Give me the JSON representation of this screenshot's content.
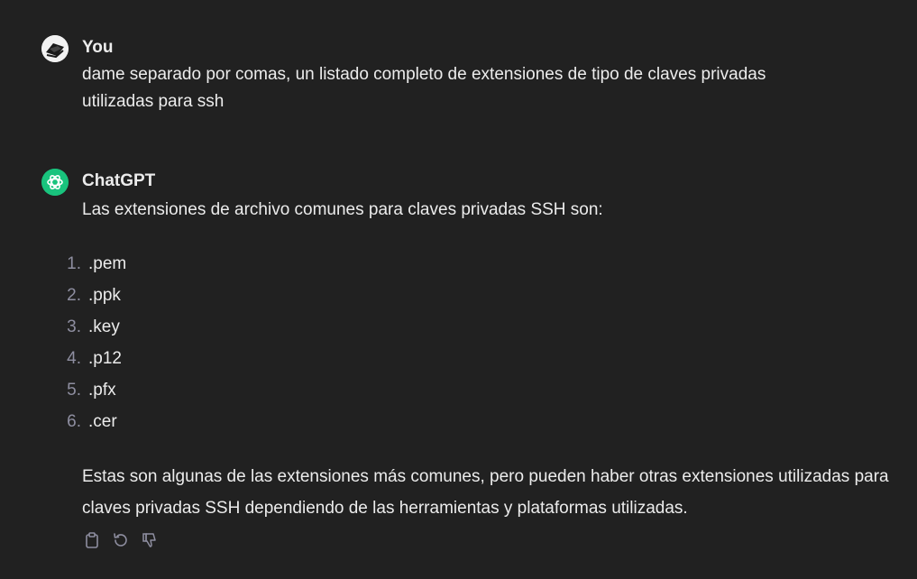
{
  "user_message": {
    "author": "You",
    "text": "dame separado por comas, un listado completo de extensiones de tipo de claves privadas utilizadas para ssh"
  },
  "assistant_message": {
    "author": "ChatGPT",
    "intro": "Las extensiones de archivo comunes para claves privadas SSH son:",
    "list": [
      {
        "num": "1.",
        "ext": ".pem"
      },
      {
        "num": "2.",
        "ext": ".ppk"
      },
      {
        "num": "3.",
        "ext": ".key"
      },
      {
        "num": "4.",
        "ext": ".p12"
      },
      {
        "num": "5.",
        "ext": ".pfx"
      },
      {
        "num": "6.",
        "ext": ".cer"
      }
    ],
    "closing": "Estas son algunas de las extensiones más comunes, pero pueden haber otras extensiones utilizadas para claves privadas SSH dependiendo de las herramientas y plataformas utilizadas."
  },
  "actions": [
    {
      "icon": "clipboard-icon"
    },
    {
      "icon": "regenerate-icon"
    },
    {
      "icon": "thumbs-down-icon"
    }
  ],
  "colors": {
    "background": "#212121",
    "text": "#ececec",
    "muted": "#8e8ea0",
    "chatgpt_green": "#19c37d"
  }
}
